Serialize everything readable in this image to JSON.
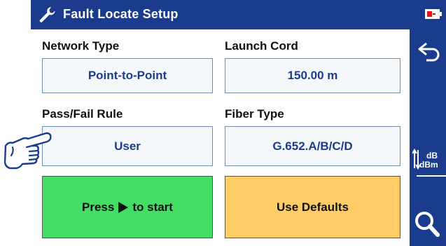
{
  "header": {
    "title": "Fault Locate Setup",
    "icon": "wrench-icon",
    "battery_icon": "battery-icon"
  },
  "fields": {
    "network_type": {
      "label": "Network Type",
      "value": "Point-to-Point"
    },
    "launch_cord": {
      "label": "Launch Cord",
      "value": "150.00 m"
    },
    "pass_fail_rule": {
      "label": "Pass/Fail Rule",
      "value": "User"
    },
    "fiber_type": {
      "label": "Fiber Type",
      "value": "G.652.A/B/C/D"
    }
  },
  "buttons": {
    "start": {
      "prefix": "Press",
      "suffix": "to start",
      "icon": "play-icon",
      "color": "#44dd66"
    },
    "defaults": {
      "label": "Use Defaults",
      "color": "#ffcc66"
    }
  },
  "sidebar": {
    "back_icon": "back-arrow-icon",
    "units_icon": "units-toggle-icon",
    "units_top": "dB",
    "units_bottom": "dBm",
    "search_icon": "search-icon"
  },
  "colors": {
    "header_bg": "#1b3c8c",
    "field_text": "#1b3c8c",
    "field_border": "#6d8fb3"
  },
  "hand_icon": "pointing-hand-icon"
}
